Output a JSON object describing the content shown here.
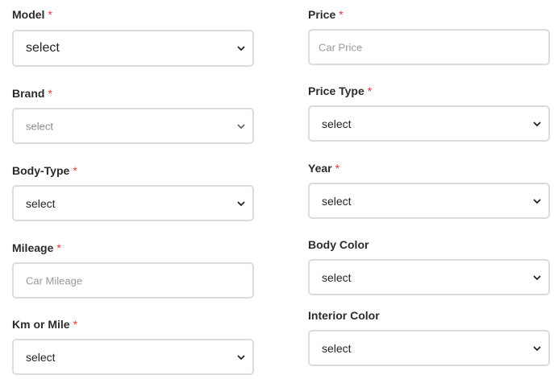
{
  "left": [
    {
      "key": "model",
      "label": "Model",
      "required": true,
      "type": "select",
      "value": "select"
    },
    {
      "key": "brand",
      "label": "Brand",
      "required": true,
      "type": "select",
      "value": "select"
    },
    {
      "key": "body_type",
      "label": "Body-Type",
      "required": true,
      "type": "select",
      "value": "select"
    },
    {
      "key": "mileage",
      "label": "Mileage",
      "required": true,
      "type": "input",
      "value": "",
      "placeholder": "Car Mileage"
    },
    {
      "key": "km_or_mile",
      "label": "Km or Mile",
      "required": true,
      "type": "select",
      "value": "select"
    }
  ],
  "right": [
    {
      "key": "price",
      "label": "Price",
      "required": true,
      "type": "input",
      "value": "",
      "placeholder": "Car Price"
    },
    {
      "key": "price_type",
      "label": "Price Type",
      "required": true,
      "type": "select",
      "value": "select"
    },
    {
      "key": "year",
      "label": "Year",
      "required": true,
      "type": "select",
      "value": "select"
    },
    {
      "key": "body_color",
      "label": "Body Color",
      "required": false,
      "type": "select",
      "value": "select"
    },
    {
      "key": "interior_color",
      "label": "Interior Color",
      "required": false,
      "type": "select",
      "value": "select"
    }
  ],
  "required_marker": "*",
  "colors": {
    "required": "#e53935",
    "border": "#dcdcdc",
    "placeholder": "#9a9a9a"
  },
  "icons": {
    "select_arrow": "chevron-down-icon"
  }
}
